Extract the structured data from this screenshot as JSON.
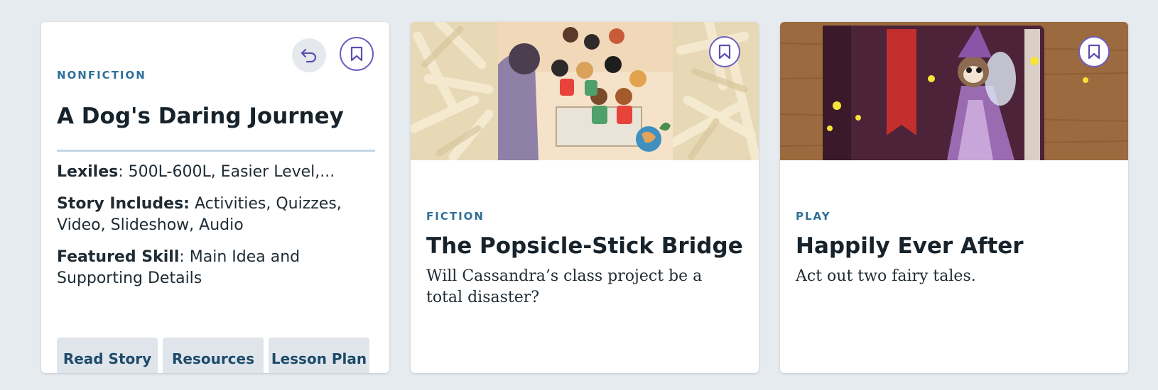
{
  "cards": [
    {
      "genre": "NONFICTION",
      "title": "A Dog's Daring Journey",
      "icons": [
        "undo-icon",
        "bookmark-icon"
      ],
      "meta": [
        {
          "label": "Lexiles",
          "sep": ":",
          "value": " 500L-600L, Easier Level,..."
        },
        {
          "label": "Story Includes:",
          "sep": "",
          "value": " Activities, Quizzes, Video, Slideshow, Audio"
        },
        {
          "label": "Featured Skill",
          "sep": ":",
          "value": " Main Idea and Supporting Details"
        }
      ],
      "buttons": [
        "Read Story",
        "Resources",
        "Lesson Plan"
      ]
    },
    {
      "genre": "FICTION",
      "title": "The Popsicle-Stick Bridge",
      "description": "Will Cassandra’s class project be a total disaster?",
      "icons": [
        "bookmark-icon"
      ]
    },
    {
      "genre": "PLAY",
      "title": "Happily Ever After",
      "description": "Act out two fairy tales.",
      "icons": [
        "bookmark-icon"
      ]
    }
  ],
  "colors": {
    "page_bg": "#e6ebef",
    "genre": "#2e7199",
    "accent": "#6e5fc0",
    "button_bg": "#dfe5eb",
    "button_text": "#1e4b69"
  }
}
